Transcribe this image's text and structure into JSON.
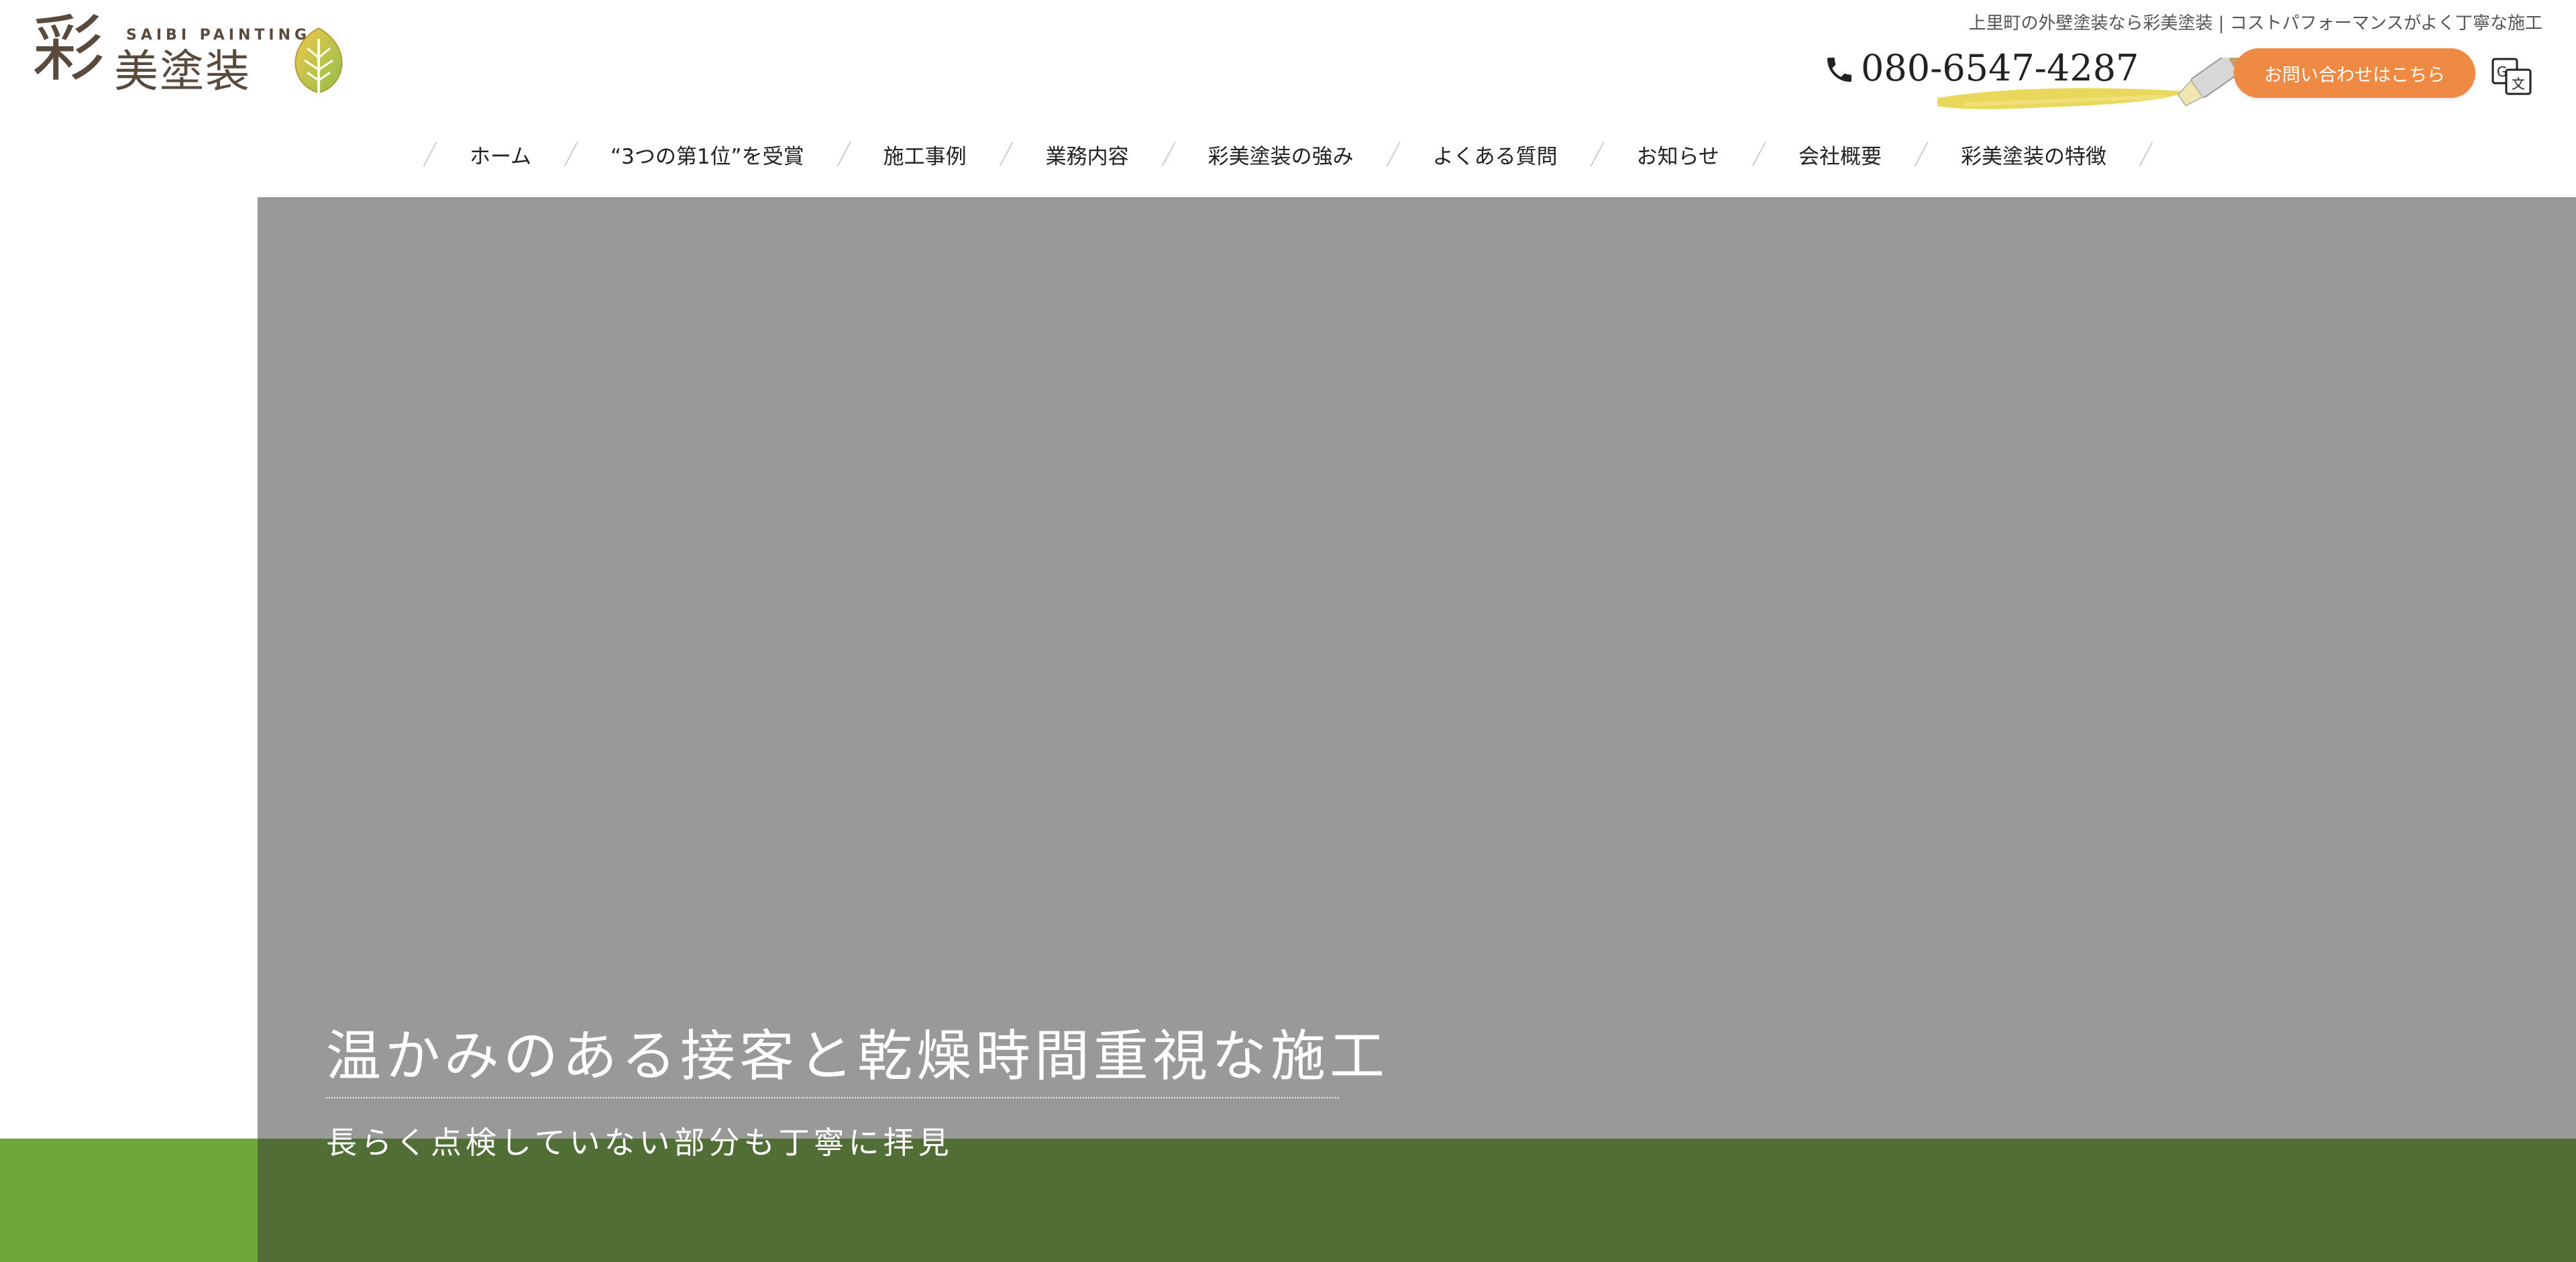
{
  "header": {
    "logo": {
      "kanji_main": "彩",
      "kanji_rest": "美塗装",
      "latin": "SAIBI PAINTING"
    },
    "tagline": "上里町の外壁塗装なら彩美塗装 | コストパフォーマンスがよく丁寧な施工",
    "phone": "080-6547-4287",
    "contact_label": "お問い合わせはこちら"
  },
  "nav": {
    "items": [
      {
        "label": "ホーム"
      },
      {
        "label": "“3つの第1位”を受賞"
      },
      {
        "label": "施工事例"
      },
      {
        "label": "業務内容"
      },
      {
        "label": "彩美塗装の強み"
      },
      {
        "label": "よくある質問"
      },
      {
        "label": "お知らせ"
      },
      {
        "label": "会社概要"
      },
      {
        "label": "彩美塗装の特徴"
      }
    ]
  },
  "hero": {
    "title": "温かみのある接客と乾燥時間重視な施工",
    "subtitle": "長らく点検していない部分も丁寧に拝見"
  },
  "colors": {
    "accent_orange": "#ef8a44",
    "brand_brown": "#5a4a3e",
    "hero_gray": "#999998",
    "green": "#6ea73a",
    "dark_green": "#516e37",
    "brush_yellow": "#e8d44a"
  },
  "icons": {
    "phone": "phone-icon",
    "leaf": "leaf-icon",
    "translate": "translate-icon",
    "brush": "paint-brush-icon"
  }
}
